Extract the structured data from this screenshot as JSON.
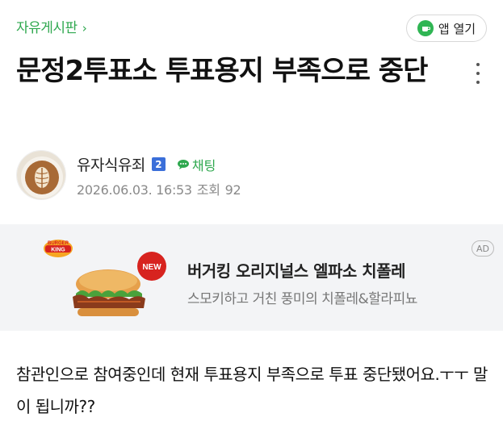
{
  "header": {
    "board_label": "자유게시판",
    "board_chevron": "›",
    "app_button_label": "앱 열기"
  },
  "post": {
    "title": "문정2투표소 투표용지 부족으로 중단",
    "author": {
      "name": "유자식유죄",
      "level": "2",
      "chat_label": "채팅"
    },
    "date": "2026.06.03. 16:53",
    "views_label": "조회",
    "views": "92",
    "body": "참관인으로 참여중인데 현재 투표용지 부족으로 투표 중단됐어요.ㅜㅜ 말이 됩니까??"
  },
  "ad": {
    "brand_logo_text": "BURGER KING",
    "new_badge": "NEW",
    "title": "버거킹 오리지널스 엘파소 치폴레",
    "description": "스모키하고 거친 풍미의 치폴레&할라피뇨",
    "badge": "AD"
  },
  "colors": {
    "accent_green": "#2fa84f",
    "level_badge_blue": "#3b6fd9",
    "ad_background": "#f3f4f6"
  }
}
